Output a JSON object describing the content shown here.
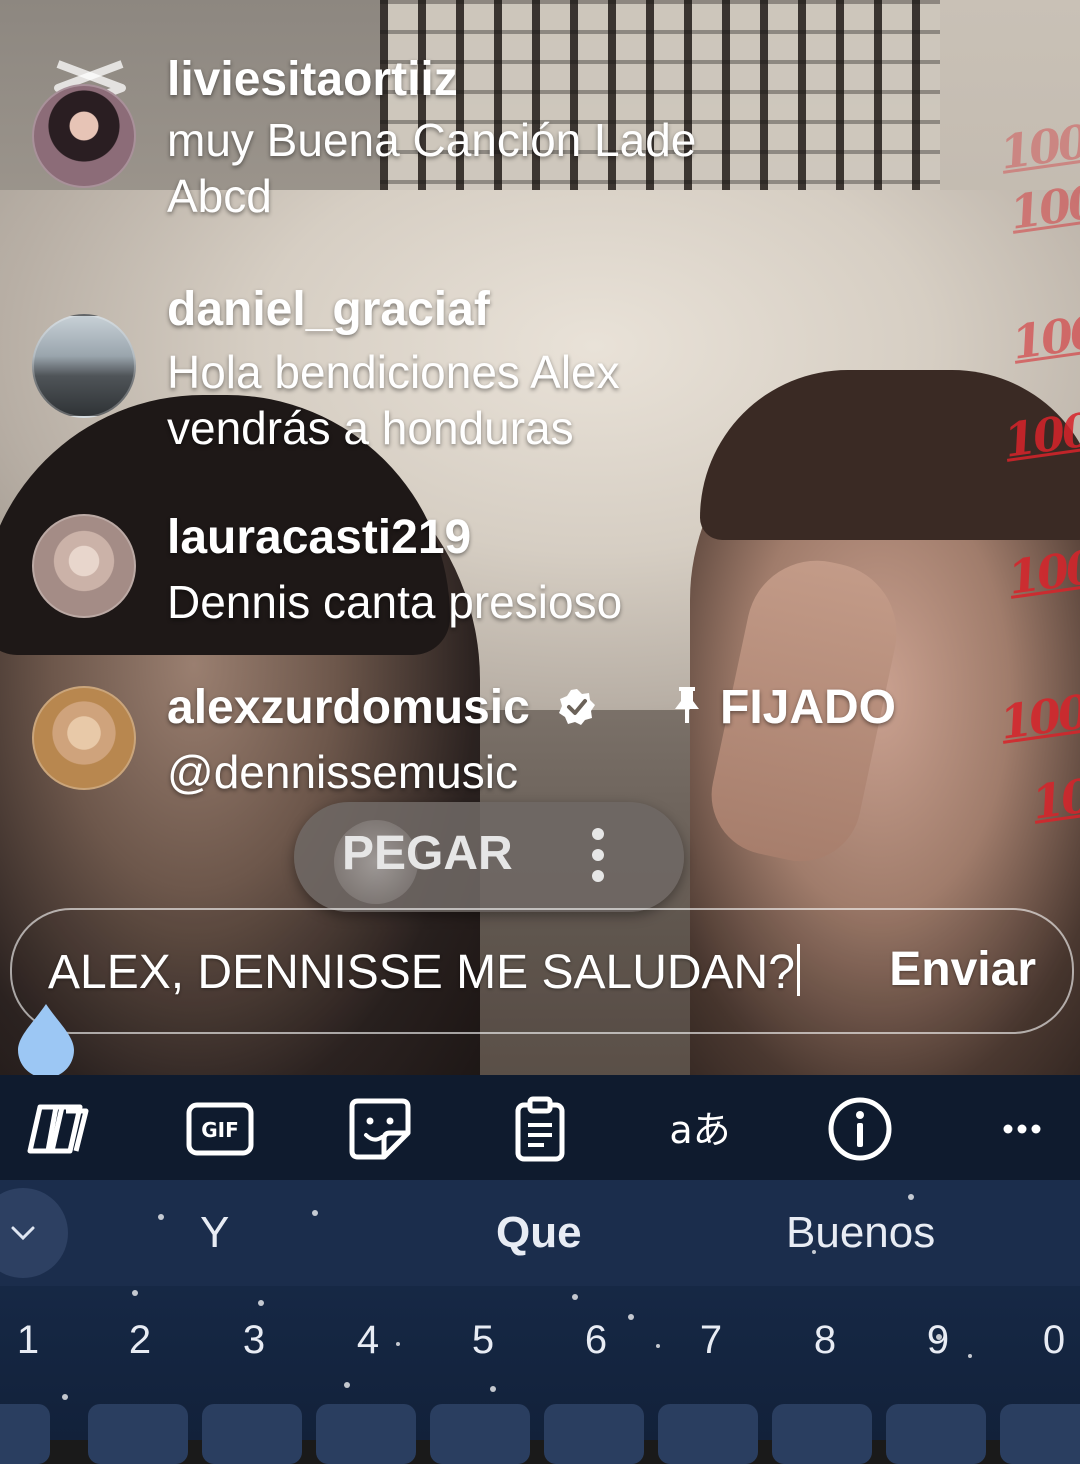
{
  "comments": [
    {
      "username": "liviesitaortiiz",
      "lines": [
        "muy Buena Canción Lade",
        "Abcd"
      ]
    },
    {
      "username": "daniel_graciaf",
      "lines": [
        "Hola bendiciones Alex",
        "vendrás a honduras"
      ]
    },
    {
      "username": "lauracasti219",
      "lines": [
        "Dennis canta presioso"
      ]
    },
    {
      "username": "alexzurdomusic",
      "pinned_label": "FIJADO",
      "lines": [
        "@dennissemusic"
      ]
    }
  ],
  "paste_popup": {
    "paste_label": "PEGAR"
  },
  "input": {
    "value": "ALEX, DENNISSE ME SALUDAN?",
    "send_label": "Enviar"
  },
  "keyboard": {
    "toolbar_icons": [
      "copilot-icon",
      "gif-icon",
      "sticker-icon",
      "clipboard-icon",
      "translate-icon",
      "info-icon",
      "more-icon"
    ],
    "suggestions": [
      "Y",
      "Que",
      "Buenos"
    ],
    "numbers": [
      "1",
      "2",
      "3",
      "4",
      "5",
      "6",
      "7",
      "8",
      "9",
      "0"
    ],
    "gif_label": "GIF",
    "translate_label": "aあ"
  },
  "overlay": {
    "hundred_emoji": "100"
  },
  "colors": {
    "accent": "#d8232a",
    "keyboard_bg": "#12213a",
    "toolbar_bg": "#0f1b2e"
  }
}
